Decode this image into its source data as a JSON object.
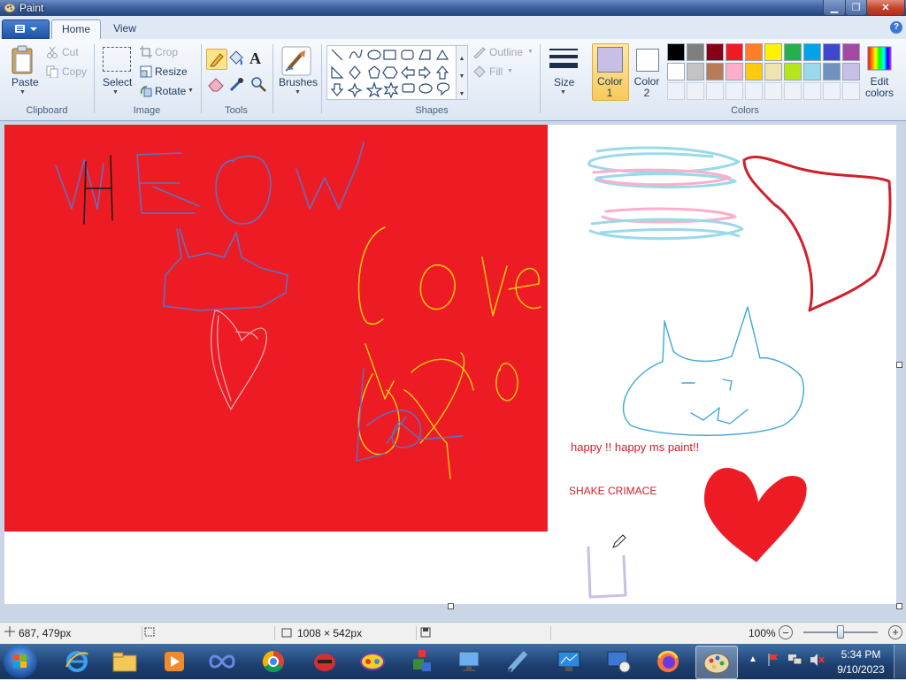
{
  "window": {
    "title": "Paint"
  },
  "tabs": {
    "home": "Home",
    "view": "View"
  },
  "clipboard": {
    "paste": "Paste",
    "cut": "Cut",
    "copy": "Copy",
    "group": "Clipboard"
  },
  "image": {
    "select": "Select",
    "crop": "Crop",
    "resize": "Resize",
    "rotate": "Rotate",
    "group": "Image"
  },
  "tools": {
    "group": "Tools"
  },
  "brushes": {
    "label": "Brushes"
  },
  "shapes": {
    "outline": "Outline",
    "fill": "Fill",
    "group": "Shapes"
  },
  "size": {
    "label": "Size"
  },
  "colors": {
    "color1": "Color 1",
    "color2": "Color 2",
    "edit": "Edit colors",
    "group": "Colors",
    "color1_value": "#c8bfe7",
    "color2_value": "#ffffff",
    "row1": [
      "#000000",
      "#7f7f7f",
      "#880015",
      "#ed1c24",
      "#ff7f27",
      "#fff200",
      "#22b14c",
      "#00a2e8",
      "#3f48cc",
      "#a349a4"
    ],
    "row2": [
      "#ffffff",
      "#c3c3c3",
      "#b97a57",
      "#ffaec9",
      "#ffc90e",
      "#efe4b0",
      "#b5e61d",
      "#99d9ea",
      "#7092be",
      "#c8bfe7"
    ]
  },
  "canvas": {
    "text1": "happy !! happy ms paint!!",
    "text2": "SHAKE CRIMACE"
  },
  "status": {
    "cursor_pos": "687, 479px",
    "canvas_size": "1008 × 542px",
    "zoom": "100%"
  },
  "taskbar": {
    "time": "5:34 PM",
    "date": "9/10/2023"
  }
}
